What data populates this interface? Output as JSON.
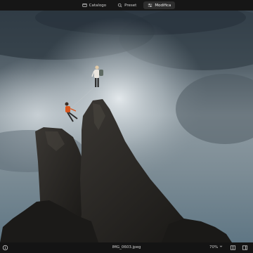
{
  "topbar": {
    "tabs": [
      {
        "label": "Catalogo",
        "icon": "library-icon",
        "active": false
      },
      {
        "label": "Preset",
        "icon": "preset-icon",
        "active": false
      },
      {
        "label": "Modifica",
        "icon": "sliders-icon",
        "active": true
      }
    ]
  },
  "photo": {
    "description_icon": "photo-canvas"
  },
  "bottombar": {
    "filename": "IMG_0603.jpeg",
    "zoom": "70%"
  },
  "colors": {
    "toolbar_bg": "#161616",
    "active_tab_bg": "#2e2e2e",
    "text": "#d0d0d0"
  }
}
